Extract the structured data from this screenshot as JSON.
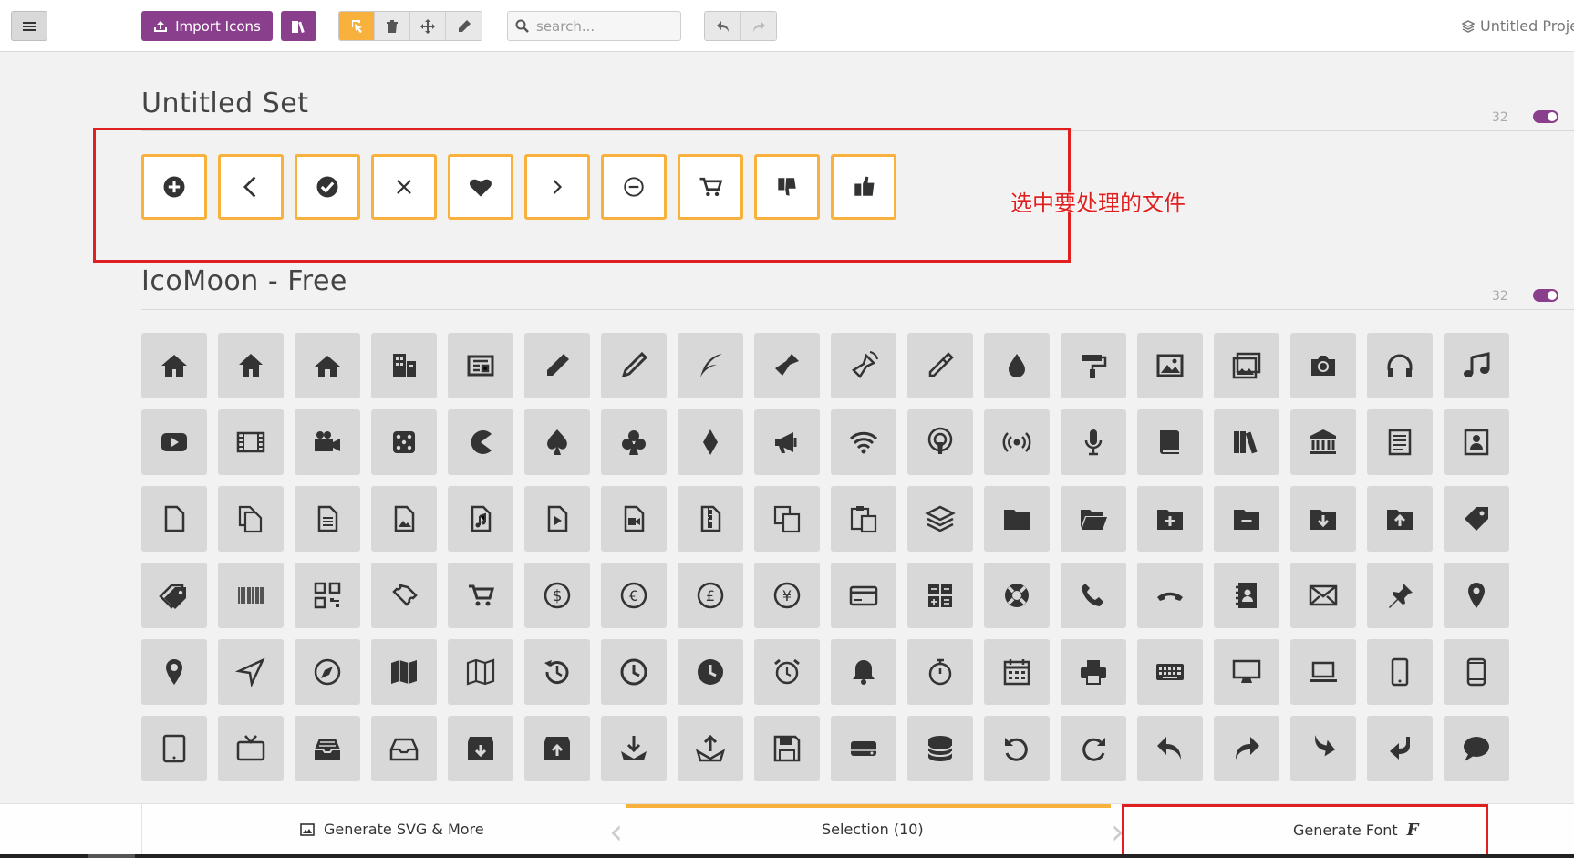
{
  "toolbar": {
    "import_label": "Import Icons",
    "search_placeholder": "search...",
    "project_name": "Untitled Proje"
  },
  "sets": [
    {
      "title": "Untitled Set",
      "count": "32"
    },
    {
      "title": "IcoMoon - Free",
      "count": "32"
    }
  ],
  "selected_icons": [
    "plus-circle",
    "arrow-left",
    "checkmark-circle",
    "cross",
    "heart",
    "arrow-right",
    "minus-circle",
    "cart",
    "thumbs-down",
    "thumbs-up"
  ],
  "grid_icons": [
    "home",
    "home2",
    "home3",
    "office",
    "newspaper",
    "pencil",
    "pencil2",
    "quill",
    "pen",
    "blog",
    "eyedropper",
    "droplet",
    "paint-format",
    "image",
    "images",
    "camera",
    "headphones",
    "music",
    "play",
    "film",
    "video-camera",
    "dice",
    "pacman",
    "spades",
    "clubs",
    "diamonds",
    "bullhorn",
    "connection",
    "podcast",
    "feed",
    "mic",
    "book",
    "books",
    "library",
    "file-text",
    "profile",
    "file-empty",
    "files-empty",
    "file-text2",
    "file-picture",
    "file-music",
    "file-play",
    "file-video",
    "file-zip",
    "copy",
    "paste",
    "stack",
    "folder",
    "folder-open",
    "folder-plus",
    "folder-minus",
    "folder-download",
    "folder-upload",
    "price-tag",
    "price-tags",
    "barcode",
    "qrcode",
    "ticket",
    "cart",
    "coin-dollar",
    "coin-euro",
    "coin-pound",
    "coin-yen",
    "credit-card",
    "calculator",
    "lifebuoy",
    "phone",
    "phone-hang-up",
    "address-book",
    "envelop",
    "pushpin",
    "location",
    "location2",
    "compass",
    "compass2",
    "map",
    "map2",
    "history",
    "clock",
    "clock2",
    "alarm",
    "bell",
    "stopwatch",
    "calendar",
    "printer",
    "keyboard",
    "display",
    "laptop",
    "mobile",
    "mobile2",
    "tablet",
    "tv",
    "drawer",
    "drawer2",
    "box-add",
    "box-remove",
    "download",
    "upload",
    "floppy-disk",
    "drive",
    "database",
    "undo",
    "redo",
    "undo2",
    "redo2",
    "forward",
    "reply",
    "bubble"
  ],
  "annotation": {
    "text": "选中要处理的文件"
  },
  "bottom": {
    "generate_svg_label": "Generate SVG & More",
    "selection_label": "Selection (10)",
    "generate_font_label": "Generate Font"
  }
}
